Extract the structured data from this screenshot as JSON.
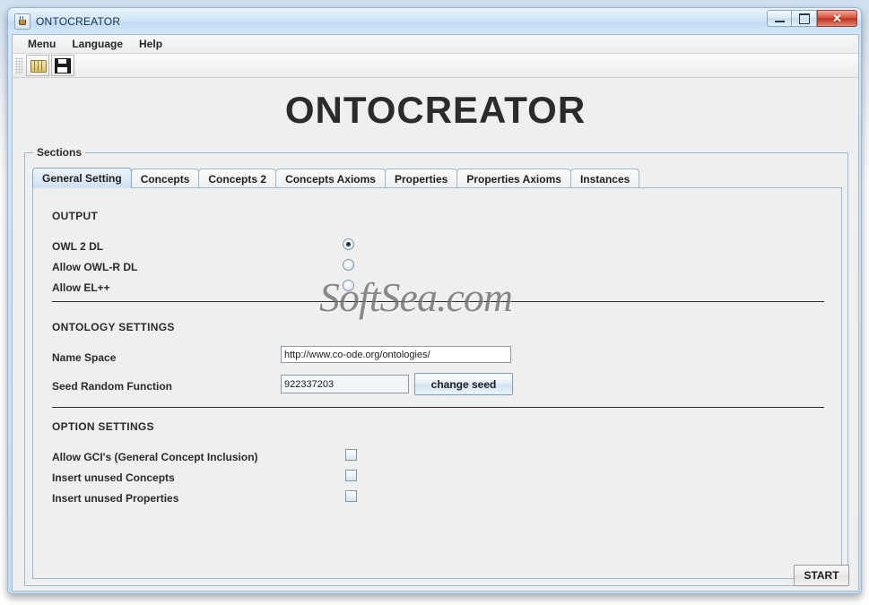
{
  "window": {
    "title": "ONTOCREATOR",
    "icon": "java-icon",
    "controls": {
      "minimize": "minimize-button",
      "maximize": "maximize-button",
      "close": "✕"
    }
  },
  "menubar": {
    "items": [
      {
        "label": "Menu"
      },
      {
        "label": "Language"
      },
      {
        "label": "Help"
      }
    ]
  },
  "toolbar": {
    "buttons": [
      {
        "name": "open-folder-icon",
        "tooltip": "Open"
      },
      {
        "name": "save-floppy-icon",
        "tooltip": "Save"
      }
    ]
  },
  "heading": "ONTOCREATOR",
  "sections": {
    "border_label": "Sections",
    "tabs": [
      {
        "label": "General Setting",
        "active": true
      },
      {
        "label": "Concepts",
        "active": false
      },
      {
        "label": "Concepts 2",
        "active": false
      },
      {
        "label": "Concepts Axioms",
        "active": false
      },
      {
        "label": "Properties",
        "active": false
      },
      {
        "label": "Properties Axioms",
        "active": false
      },
      {
        "label": "Instances",
        "active": false
      }
    ]
  },
  "general_setting": {
    "output": {
      "title": "OUTPUT",
      "options": [
        {
          "label": "OWL 2 DL",
          "selected": true
        },
        {
          "label": "Allow OWL-R DL",
          "selected": false
        },
        {
          "label": "Allow EL++",
          "selected": false
        }
      ]
    },
    "ontology_settings": {
      "title": "ONTOLOGY SETTINGS",
      "name_space": {
        "label": "Name Space",
        "value": "http://www.co-ode.org/ontologies/"
      },
      "seed": {
        "label": "Seed Random Function",
        "value": "922337203",
        "button_label": "change seed"
      }
    },
    "option_settings": {
      "title": "OPTION SETTINGS",
      "options": [
        {
          "label": "Allow GCI's (General Concept Inclusion)",
          "checked": false
        },
        {
          "label": "Insert unused Concepts",
          "checked": false
        },
        {
          "label": "Insert unused Properties",
          "checked": false
        }
      ]
    }
  },
  "footer": {
    "start_label": "START"
  },
  "watermark": "SoftSea.com"
}
